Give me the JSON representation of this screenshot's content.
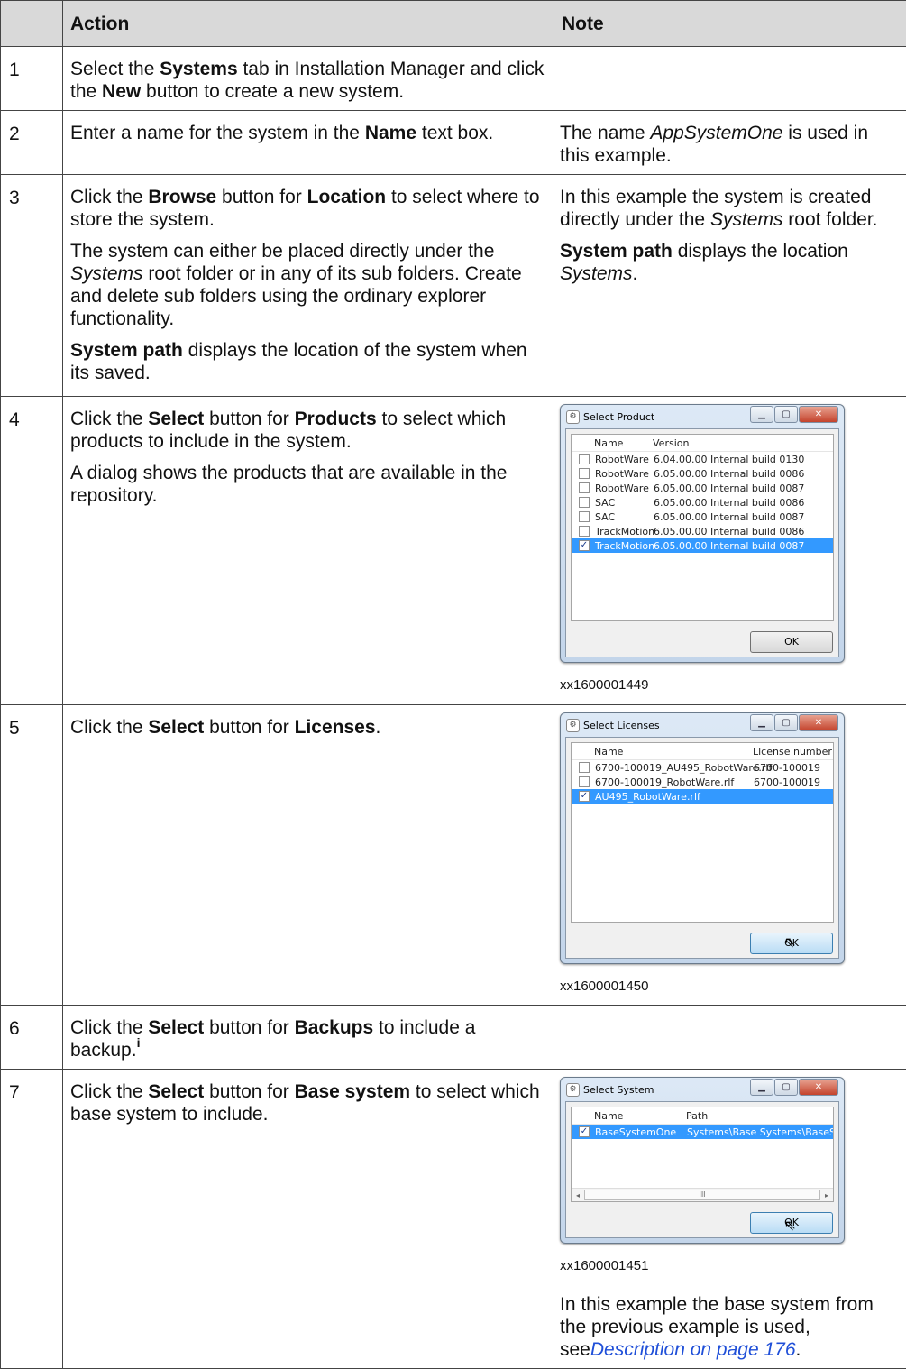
{
  "table": {
    "header": {
      "num": "",
      "action": "Action",
      "note": "Note"
    }
  },
  "steps": {
    "s1": {
      "num": "1",
      "a1": "Select the ",
      "a2": "Systems",
      "a3": " tab in Installation Manager and click the ",
      "a4": "New",
      "a5": " button to create a new system."
    },
    "s2": {
      "num": "2",
      "a1": "Enter a name for the system in the ",
      "a2": "Name",
      "a3": " text box.",
      "n1": "The name ",
      "n2": "AppSystemOne",
      "n3": " is used in this example."
    },
    "s3": {
      "num": "3",
      "a1": "Click the ",
      "a2": "Browse",
      "a3": " button for ",
      "a4": "Location",
      "a5": " to select where to store the system.",
      "b1": "The system can either be placed directly under the ",
      "b2": "Systems",
      "b3": " root folder or in any of its sub folders. Create and delete sub folders using the ordinary explorer functionality.",
      "c1": "System path",
      "c2": " displays the location of the system when its saved.",
      "n1": "In this example the system is created directly under the ",
      "n2": "Systems",
      "n3": " root folder.",
      "m1": "System path",
      "m2": " displays the location ",
      "m3": "Systems",
      "m4": "."
    },
    "s4": {
      "num": "4",
      "a1": "Click the ",
      "a2": "Select",
      "a3": " button for ",
      "a4": "Products",
      "a5": " to select which products to include in the system.",
      "b1": "A dialog shows the products that are available in the repository.",
      "caption": "xx1600001449"
    },
    "s5": {
      "num": "5",
      "a1": "Click the ",
      "a2": "Select",
      "a3": " button for ",
      "a4": "Licenses",
      "a5": ".",
      "caption": "xx1600001450"
    },
    "s6": {
      "num": "6",
      "a1": "Click the ",
      "a2": "Select",
      "a3": " button for ",
      "a4": "Backups",
      "a5": " to include a backup.",
      "sup": "i"
    },
    "s7": {
      "num": "7",
      "a1": "Click the ",
      "a2": "Select",
      "a3": " button for ",
      "a4": "Base system",
      "a5": " to select which base system to include.",
      "caption": "xx1600001451",
      "n1": "In this example the base system from the previous example is used, see",
      "n2": "Description on page 176",
      "n3": "."
    }
  },
  "dialog_product": {
    "title": "Select Product",
    "col1": "Name",
    "col2": "Version",
    "rows": [
      {
        "name": "RobotWare",
        "version": "6.04.00.00 Internal build 0130",
        "checked": false
      },
      {
        "name": "RobotWare",
        "version": "6.05.00.00 Internal build 0086",
        "checked": false
      },
      {
        "name": "RobotWare",
        "version": "6.05.00.00 Internal build 0087",
        "checked": false
      },
      {
        "name": "SAC",
        "version": "6.05.00.00 Internal build 0086",
        "checked": false
      },
      {
        "name": "SAC",
        "version": "6.05.00.00 Internal build 0087",
        "checked": false
      },
      {
        "name": "TrackMotion",
        "version": "6.05.00.00 Internal build 0086",
        "checked": false
      },
      {
        "name": "TrackMotion",
        "version": "6.05.00.00 Internal build 0087",
        "checked": true
      }
    ],
    "ok": "OK"
  },
  "dialog_licenses": {
    "title": "Select Licenses",
    "col1": "Name",
    "col2": "License number",
    "rows": [
      {
        "name": "6700-100019_AU495_RobotWare.rlf",
        "number": "6700-100019",
        "checked": false
      },
      {
        "name": "6700-100019_RobotWare.rlf",
        "number": "6700-100019",
        "checked": false
      },
      {
        "name": "AU495_RobotWare.rlf",
        "number": "",
        "checked": true
      }
    ],
    "ok": "OK"
  },
  "dialog_system": {
    "title": "Select System",
    "col1": "Name",
    "col2": "Path",
    "rows": [
      {
        "name": "BaseSystemOne",
        "path": "Systems\\Base Systems\\BaseSystemC",
        "checked": true
      }
    ],
    "scroll_mark": "III",
    "ok": "OK"
  },
  "icons": {
    "window": "window-icon",
    "minimize": "minimize-icon",
    "maximize": "maximize-icon",
    "close": "close-icon",
    "check": "checkmark-icon",
    "cursor": "mouse-cursor-icon"
  }
}
